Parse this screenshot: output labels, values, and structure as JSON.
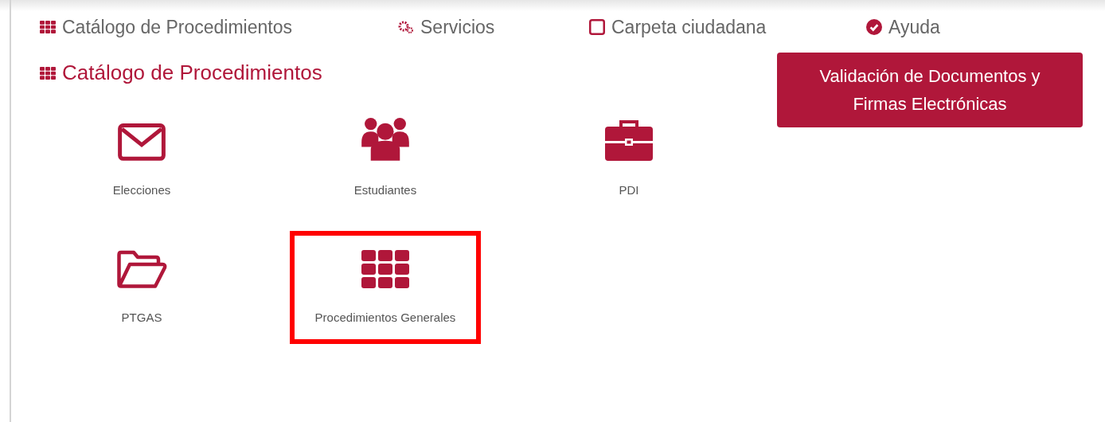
{
  "nav": [
    {
      "label": "Catálogo de Procedimientos"
    },
    {
      "label": "Servicios"
    },
    {
      "label": "Carpeta ciudadana"
    },
    {
      "label": "Ayuda"
    }
  ],
  "section_title": "Catálogo de Procedimientos",
  "validation_button": {
    "lines": [
      "Validación de Documentos y",
      "Firmas Electrónicas"
    ]
  },
  "items": [
    {
      "label": "Elecciones",
      "highlighted": false
    },
    {
      "label": "Estudiantes",
      "highlighted": false
    },
    {
      "label": "PDI",
      "highlighted": false
    },
    {
      "label": "PTGAS",
      "highlighted": false
    },
    {
      "label": "Procedimientos Generales",
      "highlighted": true
    }
  ]
}
